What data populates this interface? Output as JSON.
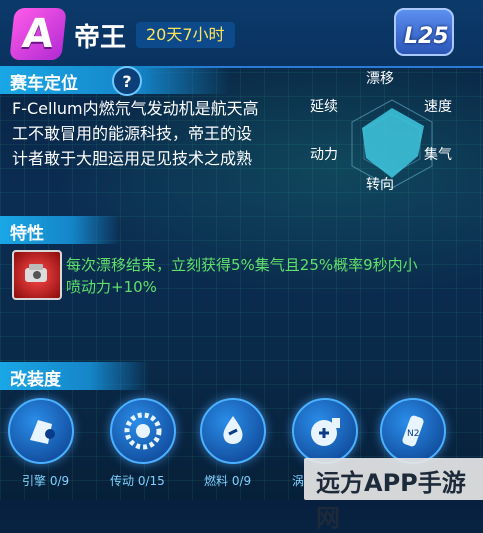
{
  "header": {
    "grade": "A",
    "car_name": "帝王",
    "time_left": "20天7小时",
    "level": "25"
  },
  "positioning": {
    "title": "赛车定位",
    "help": "?",
    "description_lines": [
      "F-Cellum内燃氘气发动机是航天高",
      "工不敢冒用的能源科技，帝王的设",
      "计者敢于大胆运用足见技术之成熟"
    ],
    "radar": {
      "labels": {
        "top": "漂移",
        "top_right": "速度",
        "bottom_right": "集气",
        "bottom": "转向",
        "bottom_left": "动力",
        "top_left": "延续"
      },
      "fill_color": "#3fc8e0"
    }
  },
  "feature": {
    "title": "特性",
    "icon": "engine-part-icon",
    "text_lines": [
      "每次漂移结束，立刻获得5%集气且25%概率9秒内小",
      "喷动力+10%"
    ]
  },
  "modification": {
    "title": "改装度",
    "parts": [
      {
        "label": "引擎 0/9",
        "icon": "engine-icon"
      },
      {
        "label": "传动 0/15",
        "icon": "gear-icon"
      },
      {
        "label": "燃料 0/9",
        "icon": "fuel-icon"
      },
      {
        "label": "涡",
        "icon": "turbo-icon"
      },
      {
        "label": "",
        "icon": "nitro-icon"
      }
    ]
  },
  "watermark": "远方APP手游网"
}
